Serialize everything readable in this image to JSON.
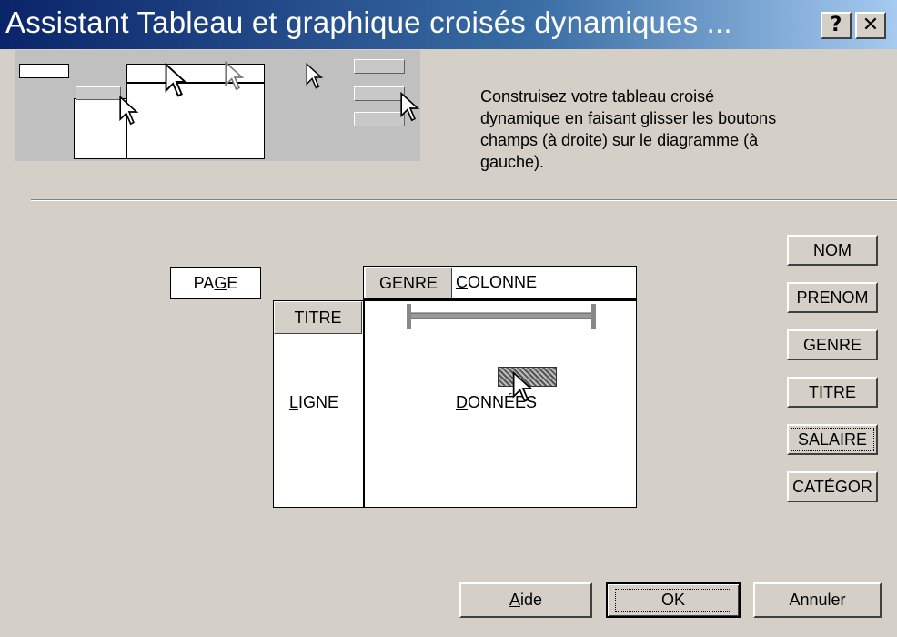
{
  "window": {
    "title": "Assistant Tableau et graphique croisés dynamiques ...",
    "help_glyph": "?",
    "close_glyph": "✕"
  },
  "instructions": "Construisez votre tableau croisé dynamique en faisant glisser les boutons champs (à droite) sur le diagramme (à gauche).",
  "layout": {
    "page_label_pre": "PA",
    "page_label_u": "G",
    "page_label_post": "E",
    "column_field": "GENRE",
    "column_label_u": "C",
    "column_label_post": "OLONNE",
    "row_field": "TITRE",
    "row_label_u": "L",
    "row_label_post": "IGNE",
    "data_label_u": "D",
    "data_label_post": "ONNÉES"
  },
  "fields": [
    "NOM",
    "PRENOM",
    "GENRE",
    "TITRE",
    "SALAIRE",
    "CATÉGOR"
  ],
  "buttons": {
    "help_u": "A",
    "help_post": "ide",
    "ok": "OK",
    "cancel": "Annuler"
  }
}
